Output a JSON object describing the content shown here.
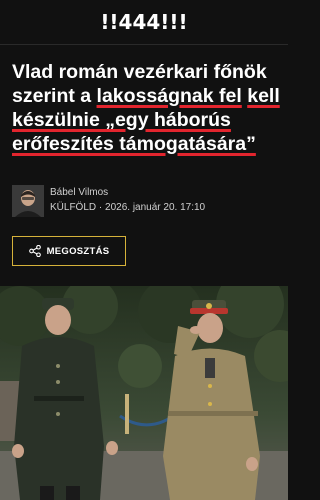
{
  "site": {
    "logo": "!!444!!!"
  },
  "article": {
    "headline": {
      "part1": "Vlad román vezérkari főnök szerint a ",
      "highlight1": "lakosságnak fel",
      "part2": " ",
      "highlight2": "kell készülnie „egy háborús erőfeszítés támogatására”",
      "part3": ""
    },
    "author": "Bábel Vilmos",
    "meta": "KÜLFÖLD · 2026. január 20. 17:10",
    "share_label": "MEGOSZTÁS"
  },
  "icons": {
    "share": "share-icon",
    "avatar": "author-avatar"
  },
  "colors": {
    "background": "#111111",
    "accent_underline": "#e3252e",
    "button_border": "#d6b23a",
    "text": "#ffffff"
  }
}
